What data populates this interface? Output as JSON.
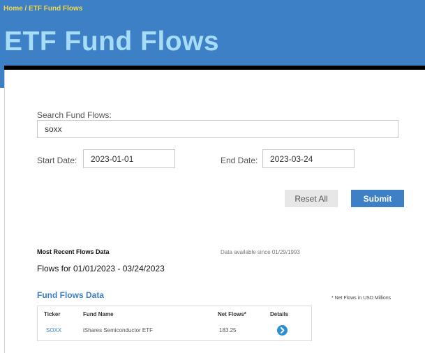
{
  "breadcrumb": "Home / ETF Fund Flows",
  "page_title": "ETF Fund Flows",
  "search": {
    "label": "Search Fund Flows:",
    "value": "soxx"
  },
  "dates": {
    "start_label": "Start Date:",
    "start_value": "2023-01-01",
    "end_label": "End Date:",
    "end_value": "2023-03-24"
  },
  "buttons": {
    "reset": "Reset All",
    "submit": "Submit"
  },
  "recent": {
    "title": "Most Recent Flows Data",
    "since": "Data available since 01/29/1993",
    "range": "Flows for 01/01/2023 - 03/24/2023"
  },
  "fund_flows": {
    "title": "Fund Flows Data",
    "note": "* Net Flows in USD Millions",
    "columns": {
      "ticker": "Ticker",
      "fund_name": "Fund Name",
      "net_flows": "Net Flows*",
      "details": "Details"
    },
    "rows": [
      {
        "ticker": "SOXX",
        "fund_name": "iShares Semiconductor ETF",
        "net_flows": "183.25",
        "details_icon": "chevron-right-circle-icon"
      }
    ]
  },
  "colors": {
    "header_blue": "#3d80c6",
    "title_light_blue": "#a6dcf7",
    "breadcrumb_yellow": "#f2d94a",
    "link_blue": "#3d80c6"
  }
}
